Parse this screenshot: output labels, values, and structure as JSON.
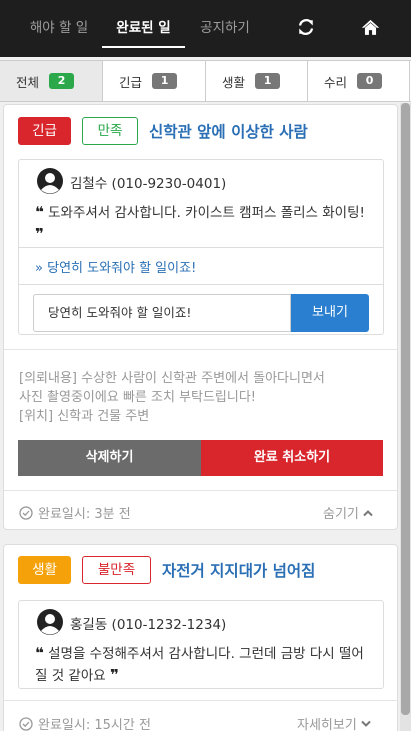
{
  "nav": {
    "tabs": [
      {
        "label": "해야 할 일"
      },
      {
        "label": "완료된 일"
      },
      {
        "label": "공지하기"
      }
    ],
    "refresh_icon": "refresh-icon",
    "home_icon": "home-icon"
  },
  "filters": [
    {
      "label": "전체",
      "count": "2"
    },
    {
      "label": "긴급",
      "count": "1"
    },
    {
      "label": "생활",
      "count": "1"
    },
    {
      "label": "수리",
      "count": "0"
    }
  ],
  "colors": {
    "nav_bg": "#1e1e1e",
    "urgent": "#d9262d",
    "life": "#f5a20a",
    "satisfied": "#2aa84a",
    "link": "#2a6fb5",
    "send": "#2a7fd0"
  },
  "cards": [
    {
      "category": "긴급",
      "rating": "만족",
      "title": "신학관 앞에 이상한 사람",
      "reviewer": "김철수 (010-9230-0401)",
      "review": "도와주셔서 감사합니다. 카이스트 캠퍼스 폴리스 화이팅!",
      "reply": "당연히 도와줘야 할 일이죠!",
      "reply_input": "당연히 도와줘야 할 일이죠!",
      "send_label": "보내기",
      "request_lines": [
        "[의뢰내용] 수상한 사람이 신학관 주변에서 돌아다니면서",
        "사진 촬영중이에요 빠른 조치 부탁드립니다!",
        "[위치] 신학과 건물 주변"
      ],
      "delete_label": "삭제하기",
      "cancel_label": "완료 취소하기",
      "completed": "완료일시: 3분 전",
      "toggle": "숨기기"
    },
    {
      "category": "생활",
      "rating": "불만족",
      "title": "자전거 지지대가 넘어짐",
      "reviewer": "홍길동 (010-1232-1234)",
      "review": "설명을 수정해주셔서 감사합니다. 그런데 금방 다시 떨어질 것 같아요",
      "completed": "완료일시: 15시간 전",
      "toggle": "자세히보기"
    }
  ]
}
